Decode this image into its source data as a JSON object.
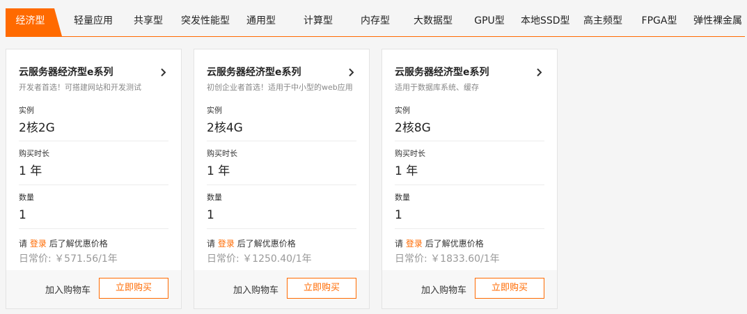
{
  "tabs": [
    {
      "label": "经济型",
      "active": true
    },
    {
      "label": "轻量应用"
    },
    {
      "label": "共享型"
    },
    {
      "label": "突发性能型"
    },
    {
      "label": "通用型"
    },
    {
      "label": "计算型"
    },
    {
      "label": "内存型"
    },
    {
      "label": "大数据型"
    },
    {
      "label": "GPU型"
    },
    {
      "label": "本地SSD型"
    },
    {
      "label": "高主频型"
    },
    {
      "label": "FPGA型"
    },
    {
      "label": "弹性裸金属"
    }
  ],
  "labels": {
    "instance": "实例",
    "duration": "购买时长",
    "quantity": "数量",
    "login_prefix": "请",
    "login_link": "登录",
    "login_suffix": "后了解优惠价格",
    "add_to_cart": "加入购物车",
    "buy_now": "立即购买"
  },
  "accent_color": "#ff6a00",
  "cards": [
    {
      "title": "云服务器经济型e系列",
      "desc": "开发者首选！可搭建网站和开发测试",
      "instance": "2核2G",
      "duration": "1 年",
      "quantity": "1",
      "price": "日常价: ￥571.56/1年"
    },
    {
      "title": "云服务器经济型e系列",
      "desc": "初创企业者首选！适用于中小型的web应用",
      "instance": "2核4G",
      "duration": "1 年",
      "quantity": "1",
      "price": "日常价: ￥1250.40/1年"
    },
    {
      "title": "云服务器经济型e系列",
      "desc": "适用于数据库系统、缓存",
      "instance": "2核8G",
      "duration": "1 年",
      "quantity": "1",
      "price": "日常价: ￥1833.60/1年"
    }
  ]
}
